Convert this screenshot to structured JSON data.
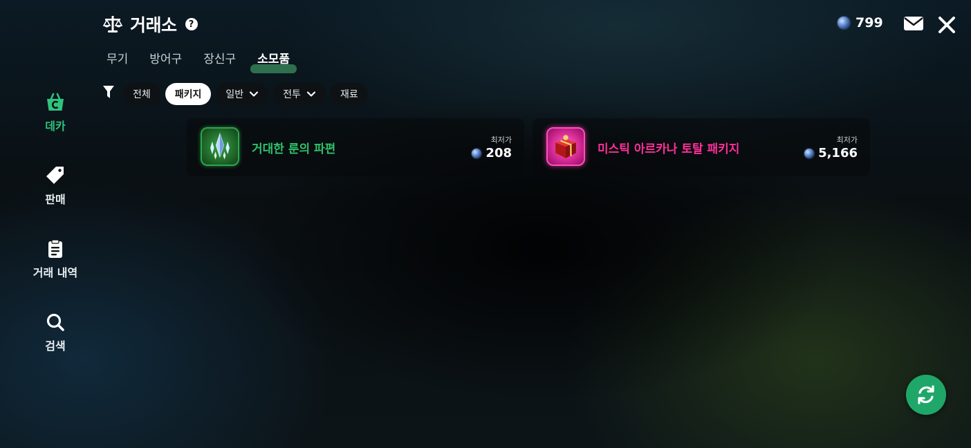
{
  "header": {
    "title": "거래소",
    "help": "?",
    "currency_value": "799"
  },
  "tabs": [
    {
      "label": "무기",
      "active": false
    },
    {
      "label": "방어구",
      "active": false
    },
    {
      "label": "장신구",
      "active": false
    },
    {
      "label": "소모품",
      "active": true
    }
  ],
  "filters": [
    {
      "label": "전체",
      "selected": false,
      "dropdown": false
    },
    {
      "label": "패키지",
      "selected": true,
      "dropdown": false
    },
    {
      "label": "일반",
      "selected": false,
      "dropdown": true
    },
    {
      "label": "전투",
      "selected": false,
      "dropdown": true
    },
    {
      "label": "재료",
      "selected": false,
      "dropdown": false
    }
  ],
  "sidebar": {
    "items": [
      {
        "label": "데카",
        "icon": "basket-icon",
        "active": true
      },
      {
        "label": "판매",
        "icon": "tag-icon",
        "active": false
      },
      {
        "label": "거래 내역",
        "icon": "clipboard-icon",
        "active": false
      },
      {
        "label": "검색",
        "icon": "search-icon",
        "active": false
      }
    ]
  },
  "items": [
    {
      "name": "거대한 룬의 파편",
      "price_label": "최저가",
      "price": "208",
      "name_color": "#2fc06a"
    },
    {
      "name": "미스틱 아르카나 토탈 패키지",
      "price_label": "최저가",
      "price": "5,166",
      "name_color": "#ff2f9a"
    }
  ],
  "colors": {
    "accent_green": "#1fa769",
    "active_tab_underline": "#2f6c4b",
    "sidebar_active": "#2fc37d"
  }
}
